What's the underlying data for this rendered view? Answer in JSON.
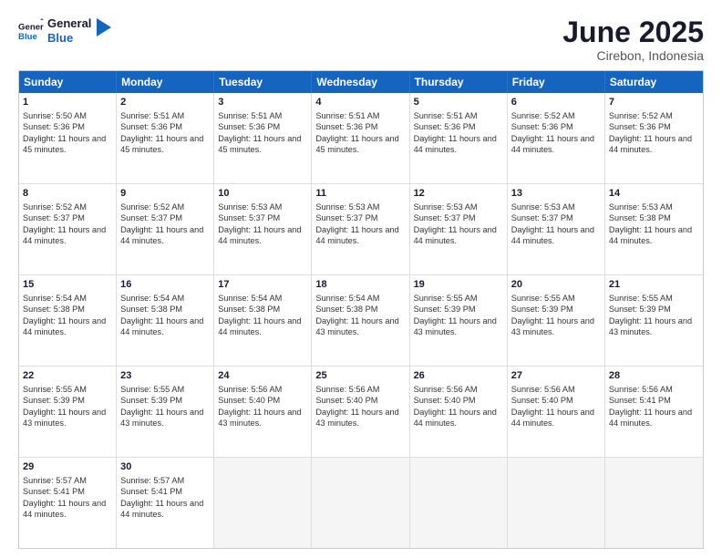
{
  "logo": {
    "line1": "General",
    "line2": "Blue"
  },
  "title": "June 2025",
  "location": "Cirebon, Indonesia",
  "days_of_week": [
    "Sunday",
    "Monday",
    "Tuesday",
    "Wednesday",
    "Thursday",
    "Friday",
    "Saturday"
  ],
  "weeks": [
    [
      {
        "day": 1,
        "sunrise": "5:50 AM",
        "sunset": "5:36 PM",
        "daylight": "11 hours and 45 minutes."
      },
      {
        "day": 2,
        "sunrise": "5:51 AM",
        "sunset": "5:36 PM",
        "daylight": "11 hours and 45 minutes."
      },
      {
        "day": 3,
        "sunrise": "5:51 AM",
        "sunset": "5:36 PM",
        "daylight": "11 hours and 45 minutes."
      },
      {
        "day": 4,
        "sunrise": "5:51 AM",
        "sunset": "5:36 PM",
        "daylight": "11 hours and 45 minutes."
      },
      {
        "day": 5,
        "sunrise": "5:51 AM",
        "sunset": "5:36 PM",
        "daylight": "11 hours and 44 minutes."
      },
      {
        "day": 6,
        "sunrise": "5:52 AM",
        "sunset": "5:36 PM",
        "daylight": "11 hours and 44 minutes."
      },
      {
        "day": 7,
        "sunrise": "5:52 AM",
        "sunset": "5:36 PM",
        "daylight": "11 hours and 44 minutes."
      }
    ],
    [
      {
        "day": 8,
        "sunrise": "5:52 AM",
        "sunset": "5:37 PM",
        "daylight": "11 hours and 44 minutes."
      },
      {
        "day": 9,
        "sunrise": "5:52 AM",
        "sunset": "5:37 PM",
        "daylight": "11 hours and 44 minutes."
      },
      {
        "day": 10,
        "sunrise": "5:53 AM",
        "sunset": "5:37 PM",
        "daylight": "11 hours and 44 minutes."
      },
      {
        "day": 11,
        "sunrise": "5:53 AM",
        "sunset": "5:37 PM",
        "daylight": "11 hours and 44 minutes."
      },
      {
        "day": 12,
        "sunrise": "5:53 AM",
        "sunset": "5:37 PM",
        "daylight": "11 hours and 44 minutes."
      },
      {
        "day": 13,
        "sunrise": "5:53 AM",
        "sunset": "5:37 PM",
        "daylight": "11 hours and 44 minutes."
      },
      {
        "day": 14,
        "sunrise": "5:53 AM",
        "sunset": "5:38 PM",
        "daylight": "11 hours and 44 minutes."
      }
    ],
    [
      {
        "day": 15,
        "sunrise": "5:54 AM",
        "sunset": "5:38 PM",
        "daylight": "11 hours and 44 minutes."
      },
      {
        "day": 16,
        "sunrise": "5:54 AM",
        "sunset": "5:38 PM",
        "daylight": "11 hours and 44 minutes."
      },
      {
        "day": 17,
        "sunrise": "5:54 AM",
        "sunset": "5:38 PM",
        "daylight": "11 hours and 44 minutes."
      },
      {
        "day": 18,
        "sunrise": "5:54 AM",
        "sunset": "5:38 PM",
        "daylight": "11 hours and 43 minutes."
      },
      {
        "day": 19,
        "sunrise": "5:55 AM",
        "sunset": "5:39 PM",
        "daylight": "11 hours and 43 minutes."
      },
      {
        "day": 20,
        "sunrise": "5:55 AM",
        "sunset": "5:39 PM",
        "daylight": "11 hours and 43 minutes."
      },
      {
        "day": 21,
        "sunrise": "5:55 AM",
        "sunset": "5:39 PM",
        "daylight": "11 hours and 43 minutes."
      }
    ],
    [
      {
        "day": 22,
        "sunrise": "5:55 AM",
        "sunset": "5:39 PM",
        "daylight": "11 hours and 43 minutes."
      },
      {
        "day": 23,
        "sunrise": "5:55 AM",
        "sunset": "5:39 PM",
        "daylight": "11 hours and 43 minutes."
      },
      {
        "day": 24,
        "sunrise": "5:56 AM",
        "sunset": "5:40 PM",
        "daylight": "11 hours and 43 minutes."
      },
      {
        "day": 25,
        "sunrise": "5:56 AM",
        "sunset": "5:40 PM",
        "daylight": "11 hours and 43 minutes."
      },
      {
        "day": 26,
        "sunrise": "5:56 AM",
        "sunset": "5:40 PM",
        "daylight": "11 hours and 44 minutes."
      },
      {
        "day": 27,
        "sunrise": "5:56 AM",
        "sunset": "5:40 PM",
        "daylight": "11 hours and 44 minutes."
      },
      {
        "day": 28,
        "sunrise": "5:56 AM",
        "sunset": "5:41 PM",
        "daylight": "11 hours and 44 minutes."
      }
    ],
    [
      {
        "day": 29,
        "sunrise": "5:57 AM",
        "sunset": "5:41 PM",
        "daylight": "11 hours and 44 minutes."
      },
      {
        "day": 30,
        "sunrise": "5:57 AM",
        "sunset": "5:41 PM",
        "daylight": "11 hours and 44 minutes."
      },
      null,
      null,
      null,
      null,
      null
    ]
  ]
}
